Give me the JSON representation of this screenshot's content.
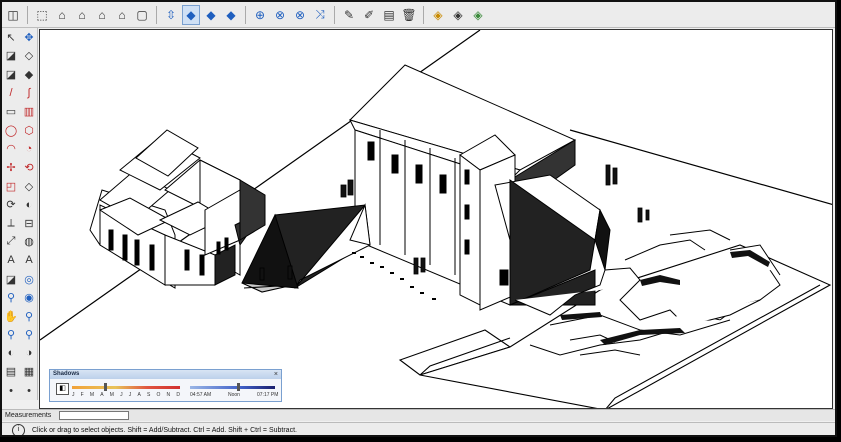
{
  "toolbar": {
    "items": [
      {
        "name": "get-models-icon",
        "glyph": "◫"
      },
      {
        "name": "iso-view-icon",
        "glyph": "⬚"
      },
      {
        "name": "top-view-icon",
        "glyph": "⌂"
      },
      {
        "name": "front-view-icon",
        "glyph": "⌂"
      },
      {
        "name": "right-view-icon",
        "glyph": "⌂"
      },
      {
        "name": "back-view-icon",
        "glyph": "⌂"
      },
      {
        "name": "left-view-icon",
        "glyph": "▢"
      },
      {
        "name": "xray-style-icon",
        "glyph": "⇳"
      },
      {
        "name": "wireframe-style-icon",
        "glyph": "◆"
      },
      {
        "name": "hidden-line-style-icon",
        "glyph": "◆"
      },
      {
        "name": "shaded-style-icon",
        "glyph": "◆"
      },
      {
        "name": "zoom-icon",
        "glyph": "⊕"
      },
      {
        "name": "zoom-window-icon",
        "glyph": "⊗"
      },
      {
        "name": "zoom-extents-icon",
        "glyph": "⊗"
      },
      {
        "name": "previous-view-icon",
        "glyph": "⤨"
      },
      {
        "name": "pencil-line-icon",
        "glyph": "✎"
      },
      {
        "name": "text-label-icon",
        "glyph": "✐"
      },
      {
        "name": "dimension-icon",
        "glyph": "▤"
      },
      {
        "name": "trash-icon",
        "glyph": "🗑"
      },
      {
        "name": "components-icon",
        "glyph": "◈"
      },
      {
        "name": "materials-icon",
        "glyph": "◈"
      },
      {
        "name": "warehouse-icon",
        "glyph": "◈"
      }
    ]
  },
  "left_tools": [
    {
      "name": "select-icon",
      "glyph": "↖"
    },
    {
      "name": "orbit-icon",
      "glyph": "✥"
    },
    {
      "name": "paint-bucket-icon",
      "glyph": "◪"
    },
    {
      "name": "eraser-icon",
      "glyph": "◇"
    },
    {
      "name": "tape-icon",
      "glyph": "◪"
    },
    {
      "name": "push-pull-icon",
      "glyph": "◆"
    },
    {
      "name": "line-icon",
      "glyph": "/"
    },
    {
      "name": "freehand-icon",
      "glyph": "∫"
    },
    {
      "name": "rectangle-icon",
      "glyph": "▭"
    },
    {
      "name": "rotated-rect-icon",
      "glyph": "▥"
    },
    {
      "name": "circle-icon",
      "glyph": "◯"
    },
    {
      "name": "polygon-icon",
      "glyph": "⬡"
    },
    {
      "name": "arc-icon",
      "glyph": "◠"
    },
    {
      "name": "pie-icon",
      "glyph": "◔"
    },
    {
      "name": "move-icon",
      "glyph": "✢"
    },
    {
      "name": "rotate-icon",
      "glyph": "⟲"
    },
    {
      "name": "scale-icon",
      "glyph": "◰"
    },
    {
      "name": "offset-icon",
      "glyph": "◇"
    },
    {
      "name": "follow-me-icon",
      "glyph": "⟳"
    },
    {
      "name": "followme-alt-icon",
      "glyph": "◐"
    },
    {
      "name": "axes-icon",
      "glyph": "⟂"
    },
    {
      "name": "section-icon",
      "glyph": "⊟"
    },
    {
      "name": "dimension-tool-icon",
      "glyph": "⤢"
    },
    {
      "name": "protractor-icon",
      "glyph": "◍"
    },
    {
      "name": "text-tool-icon",
      "glyph": "A"
    },
    {
      "name": "3d-text-icon",
      "glyph": "A"
    },
    {
      "name": "tape-measure-icon",
      "glyph": "◪"
    },
    {
      "name": "position-camera-icon",
      "glyph": "◎"
    },
    {
      "name": "walk-icon",
      "glyph": "⚲"
    },
    {
      "name": "look-around-icon",
      "glyph": "◉"
    },
    {
      "name": "pan-icon",
      "glyph": "✋"
    },
    {
      "name": "zoom-tool-icon",
      "glyph": "⚲"
    },
    {
      "name": "zoom-window-tool-icon",
      "glyph": "⚲"
    },
    {
      "name": "zoom-extents-tool-icon",
      "glyph": "⚲"
    },
    {
      "name": "section-fill-icon",
      "glyph": "◐"
    },
    {
      "name": "display-section-icon",
      "glyph": "◑"
    },
    {
      "name": "shadow-icon",
      "glyph": "▤"
    },
    {
      "name": "fog-icon",
      "glyph": "▦"
    },
    {
      "name": "more-tools-icon",
      "glyph": "•"
    },
    {
      "name": "more-tools-icon-2",
      "glyph": "•"
    }
  ],
  "shadows": {
    "title": "Shadows",
    "close": "×",
    "toggle": "◧",
    "months": [
      "J",
      "F",
      "M",
      "A",
      "M",
      "J",
      "J",
      "A",
      "S",
      "O",
      "N",
      "D"
    ],
    "month_level": 0.3,
    "time_level": 0.55,
    "time_start": "04:57 AM",
    "time_mid": "Noon",
    "time_end": "07:17 PM"
  },
  "measurements": {
    "label": "Measurements",
    "value": ""
  },
  "status": {
    "icon": "i",
    "text": "Click or drag to select objects. Shift = Add/Subtract. Ctrl = Add. Shift + Ctrl = Subtract."
  }
}
